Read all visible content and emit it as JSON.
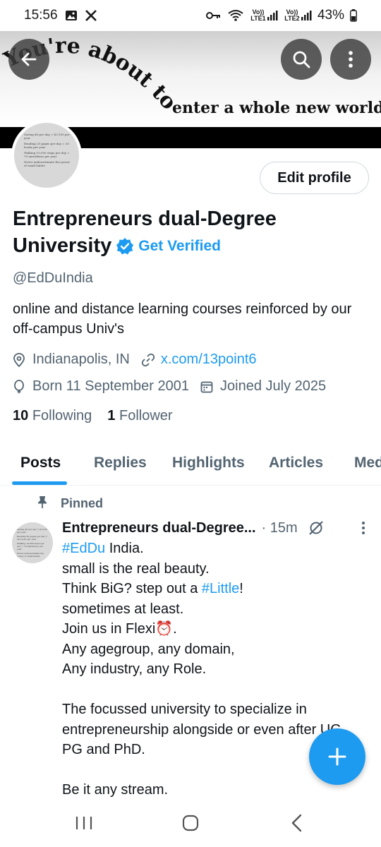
{
  "status_bar": {
    "time": "15:56",
    "lte1": "Vo)) LTE1",
    "lte2": "Vo)) LTE2",
    "battery": "43%"
  },
  "banner": {
    "arc_text": "You're about to",
    "line_text": "enter a whole new world"
  },
  "avatar_text": [
    "Saving $0 per day = $3,100 per year",
    "Reading 20 pages per day = 30 books per year",
    "Walking 10,000 steps per day = 70 marathons per year",
    "Never underestimate the power of small habits"
  ],
  "profile": {
    "edit_button": "Edit profile",
    "name": "Entrepreneurs dual-Degree University",
    "get_verified": "Get Verified",
    "handle": "@EdDuIndia",
    "bio": "online and distance learning courses reinforced by our off-campus Univ's",
    "location": "Indianapolis, IN",
    "website": "x.com/13point6",
    "born": "Born 11 September 2001",
    "joined": "Joined July 2025",
    "following_count": "10",
    "following_label": "Following",
    "followers_count": "1",
    "followers_label": "Follower"
  },
  "tabs": [
    "Posts",
    "Replies",
    "Highlights",
    "Articles",
    "Med"
  ],
  "post": {
    "pinned_label": "Pinned",
    "author": "Entrepreneurs dual-Degree...",
    "time": "· 15m",
    "lines": {
      "l1_tag": "#EdDu",
      "l1_rest": " India.",
      "l2": "small is the real beauty.",
      "l3_pre": "Think BiG? step out a ",
      "l3_tag": "#Little",
      "l3_post": "!",
      "l4": "sometimes at least.",
      "l5": "Join us in Flexi⏰.",
      "l6": "Any agegroup, any domain,",
      "l7": "Any industry, any Role.",
      "l8": "The focussed university to specialize in",
      "l9": "entrepreneurship alongside or even after UG,",
      "l10": "PG and PhD.",
      "l11": "Be it any stream."
    }
  },
  "colors": {
    "accent": "#1d9bf0",
    "text": "#0f1419",
    "muted": "#536471"
  }
}
